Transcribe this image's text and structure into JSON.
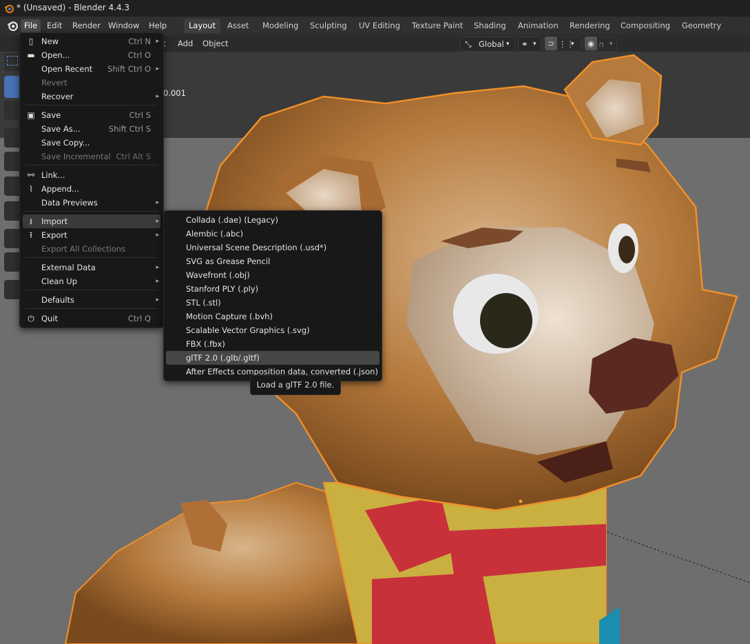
{
  "window": {
    "title": "* (Unsaved) - Blender 4.4.3"
  },
  "topmenu": [
    "File",
    "Edit",
    "Render",
    "Window",
    "Help"
  ],
  "workspaces": [
    "Layout",
    "Asset",
    "Modeling",
    "Sculpting",
    "UV Editing",
    "Texture Paint",
    "Shading",
    "Animation",
    "Rendering",
    "Compositing",
    "Geometry Nodes"
  ],
  "header": {
    "view_label": "t",
    "add": "Add",
    "object": "Object",
    "orientation": "Global"
  },
  "viewport": {
    "value_readout": "0.001"
  },
  "file_menu": {
    "new": "New",
    "new_sc": "Ctrl N",
    "open": "Open...",
    "open_sc": "Ctrl O",
    "open_recent": "Open Recent",
    "open_recent_sc": "Shift Ctrl O",
    "revert": "Revert",
    "recover": "Recover",
    "save": "Save",
    "save_sc": "Ctrl S",
    "save_as": "Save As...",
    "save_as_sc": "Shift Ctrl S",
    "save_copy": "Save Copy...",
    "save_incremental": "Save Incremental",
    "save_incremental_sc": "Ctrl Alt S",
    "link": "Link...",
    "append": "Append...",
    "data_previews": "Data Previews",
    "import": "Import",
    "export": "Export",
    "export_all": "Export All Collections",
    "external_data": "External Data",
    "clean_up": "Clean Up",
    "defaults": "Defaults",
    "quit": "Quit",
    "quit_sc": "Ctrl Q"
  },
  "import_menu": [
    "Collada (.dae) (Legacy)",
    "Alembic (.abc)",
    "Universal Scene Description (.usd*)",
    "SVG as Grease Pencil",
    "Wavefront (.obj)",
    "Stanford PLY (.ply)",
    "STL (.stl)",
    "Motion Capture (.bvh)",
    "Scalable Vector Graphics (.svg)",
    "FBX (.fbx)",
    "glTF 2.0 (.glb/.gltf)",
    "After Effects composition data, converted (.json)"
  ],
  "tooltip": "Load a glTF 2.0 file."
}
